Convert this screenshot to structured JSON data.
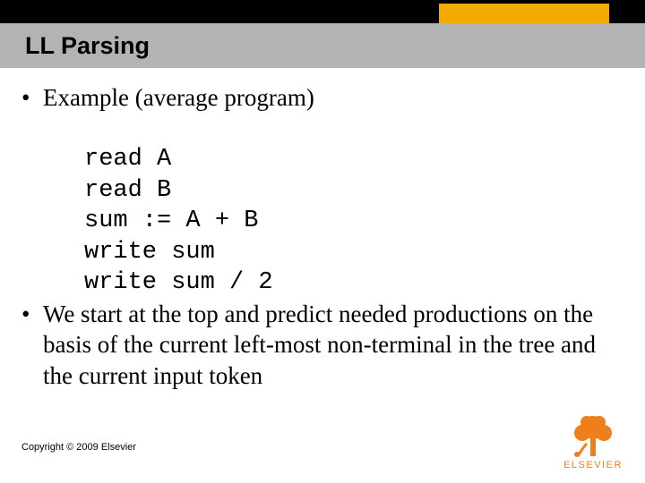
{
  "header": {
    "title": "LL Parsing"
  },
  "body": {
    "bullet1": "Example (average program)",
    "code": {
      "l1": "read A",
      "l2": "read B",
      "l3": "sum := A + B",
      "l4": "write sum",
      "l5": "write sum / 2"
    },
    "bullet2": "We start at the top and predict needed productions on the basis of the current left-most non-terminal in the tree and the current input token"
  },
  "footer": {
    "copyright": "Copyright © 2009 Elsevier",
    "publisher": "ELSEVIER"
  },
  "colors": {
    "accent_orange": "#f2a900",
    "brand_orange": "#ef7f1a",
    "titlebar_grey": "#b3b3b3"
  }
}
